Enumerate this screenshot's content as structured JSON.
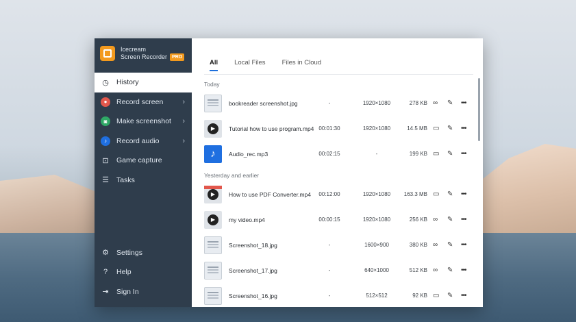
{
  "app": {
    "brand_line1": "Icecream",
    "brand_line2": "Screen Recorder",
    "pro_badge": "PRO"
  },
  "sidebar": {
    "items": [
      {
        "label": "History",
        "icon": "clock-icon",
        "active": true
      },
      {
        "label": "Record screen",
        "icon": "record-icon",
        "color": "#e2574c",
        "has_submenu": true
      },
      {
        "label": "Make screenshot",
        "icon": "camera-icon",
        "color": "#2fa866",
        "has_submenu": true
      },
      {
        "label": "Record audio",
        "icon": "microphone-icon",
        "color": "#1f6fe0",
        "has_submenu": true
      },
      {
        "label": "Game capture",
        "icon": "gamepad-icon"
      },
      {
        "label": "Tasks",
        "icon": "tasks-icon"
      }
    ],
    "bottom": [
      {
        "label": "Settings",
        "icon": "gear-icon"
      },
      {
        "label": "Help",
        "icon": "help-icon"
      },
      {
        "label": "Sign In",
        "icon": "sign-in-icon"
      }
    ]
  },
  "tabs": [
    {
      "label": "All",
      "active": true
    },
    {
      "label": "Local Files"
    },
    {
      "label": "Files in Cloud"
    }
  ],
  "sections": {
    "today": "Today",
    "earlier": "Yesterday and earlier"
  },
  "files_today": [
    {
      "name": "bookreader screenshot.jpg",
      "duration": "-",
      "resolution": "1920×1080",
      "size": "278 KB",
      "type": "image",
      "first_action": "link-icon"
    },
    {
      "name": "Tutorial how to use program.mp4",
      "duration": "00:01:30",
      "resolution": "1920×1080",
      "size": "14.5 MB",
      "type": "video",
      "first_action": "folder-icon"
    },
    {
      "name": "Audio_rec.mp3",
      "duration": "00:02:15",
      "resolution": "-",
      "size": "199 KB",
      "type": "audio",
      "first_action": "folder-icon"
    }
  ],
  "files_earlier": [
    {
      "name": "How to use PDF Converter.mp4",
      "duration": "00:12:00",
      "resolution": "1920×1080",
      "size": "163.3 MB",
      "type": "video-red",
      "first_action": "folder-icon"
    },
    {
      "name": "my video.mp4",
      "duration": "00:00:15",
      "resolution": "1920×1080",
      "size": "256 KB",
      "type": "video",
      "first_action": "link-icon"
    },
    {
      "name": "Screenshot_18.jpg",
      "duration": "-",
      "resolution": "1600×900",
      "size": "380 KB",
      "type": "image",
      "first_action": "link-icon"
    },
    {
      "name": "Screenshot_17.jpg",
      "duration": "-",
      "resolution": "640×1000",
      "size": "512 KB",
      "type": "image",
      "first_action": "link-icon"
    },
    {
      "name": "Screenshot_16.jpg",
      "duration": "-",
      "resolution": "512×512",
      "size": "92 KB",
      "type": "image",
      "first_action": "folder-icon"
    }
  ]
}
